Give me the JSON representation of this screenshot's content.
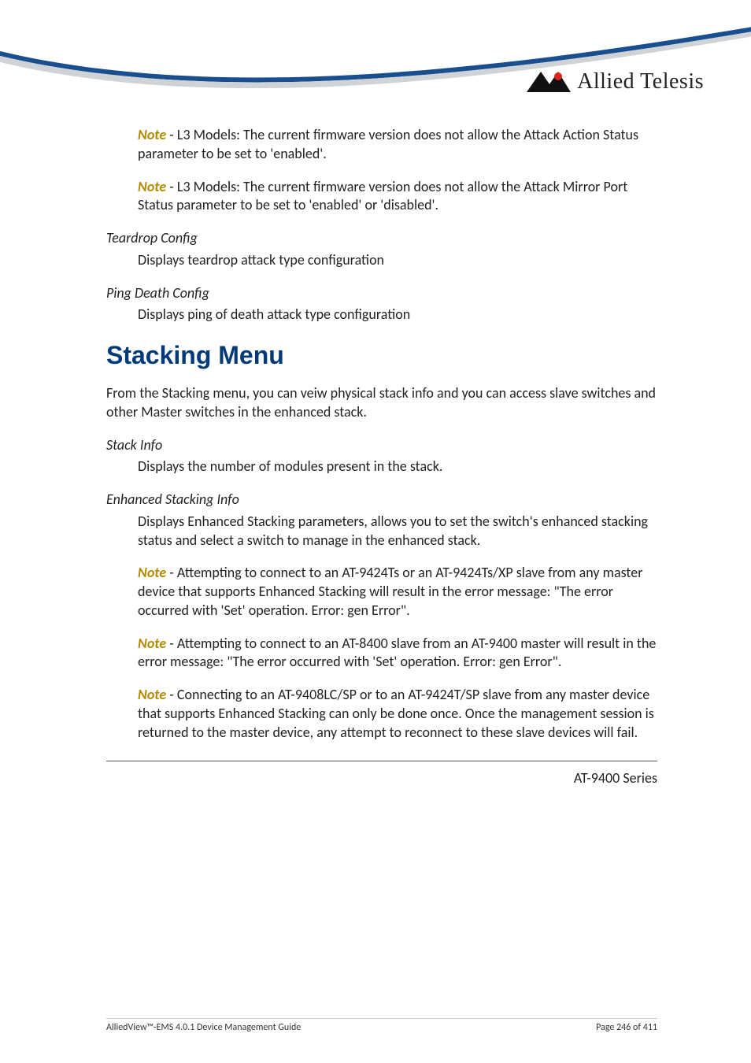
{
  "logo": {
    "text": "Allied Telesis"
  },
  "note_label": "Note",
  "notes": {
    "n1_a": " - L3 Models: The current firmware version does not allow the Attack Action Status parameter to be set to 'enabled'.",
    "n2_a": " - L3 Models: The current firmware version does not allow the Attack Mirror Port Status parameter to be set to 'enabled' or 'disabled'.",
    "n3_a": " - Attempting to connect to an AT-9424Ts or an AT-9424Ts/XP slave from any master device that supports Enhanced Stacking will result in the error message: \"The error occurred with 'Set' operation. Error: gen Error\".",
    "n4_a": " - Attempting to connect to an AT-8400 slave from an AT-9400 master will result in the error message: \"The error occurred with 'Set' operation. Error: gen Error\".",
    "n5_a": " - Connecting to an AT-9408LC/SP or to an AT-9424T/SP slave from any master device that supports Enhanced Stacking can only be done once. Once the management session is returned to the master device, any attempt to reconnect to these slave devices will fail."
  },
  "defs": {
    "teardrop": {
      "term": "Teardrop Config",
      "desc": "Displays teardrop attack type configuration"
    },
    "pingdeath": {
      "term": "Ping Death Config",
      "desc": "Displays ping of death attack type configuration"
    },
    "stackinfo": {
      "term": "Stack Info",
      "desc": "Displays the number of modules present in the stack."
    },
    "enhstack": {
      "term": "Enhanced Stacking Info",
      "desc": "Displays Enhanced Stacking parameters, allows you to set the switch's enhanced stacking status and select a switch to manage in the enhanced stack."
    }
  },
  "section": {
    "title": "Stacking Menu",
    "intro": "From the Stacking menu, you can veiw physical stack info and you can access slave switches and other Master switches in the enhanced stack."
  },
  "series_label": "AT-9400 Series",
  "footer": {
    "left": "AlliedView™-EMS 4.0.1 Device Management Guide",
    "right": "Page 246 of 411"
  }
}
